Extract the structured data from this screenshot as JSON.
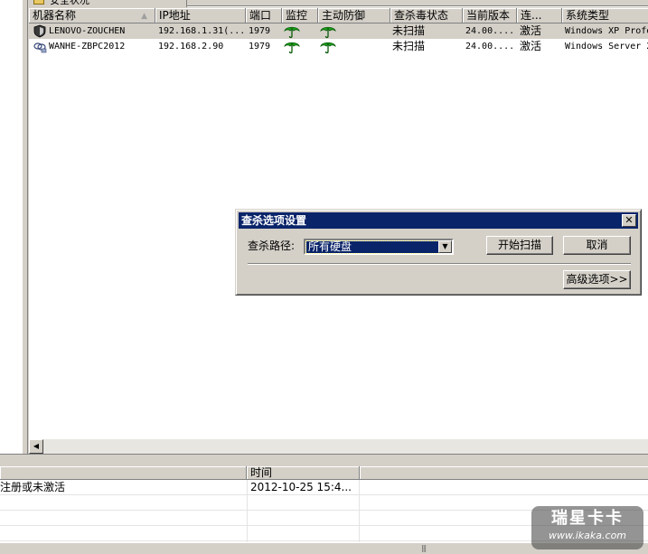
{
  "top_tab": {
    "label": "安全状况"
  },
  "machine_list": {
    "columns": [
      {
        "label": "机器名称"
      },
      {
        "label": "IP地址"
      },
      {
        "label": "端口"
      },
      {
        "label": "监控"
      },
      {
        "label": "主动防御"
      },
      {
        "label": "查杀毒状态"
      },
      {
        "label": "当前版本"
      },
      {
        "label": "连..."
      },
      {
        "label": "系统类型"
      }
    ],
    "sorted_column": "机器名称",
    "rows": [
      {
        "name": "LENOVO-ZOUCHEN",
        "icon": "shield-pc-icon",
        "ip": "192.168.1.31(...",
        "port": "1979",
        "monitor_icon": "umbrella-icon",
        "defense_icon": "umbrella-icon",
        "scan_status": "未扫描",
        "version": "24.00....",
        "connection": "激活",
        "os": "Windows XP Professional",
        "selected": true
      },
      {
        "name": "WANHE-ZBPC2012",
        "icon": "network-pc-icon",
        "ip": "192.168.2.90",
        "port": "1979",
        "monitor_icon": "umbrella-icon",
        "defense_icon": "umbrella-icon",
        "scan_status": "未扫描",
        "version": "24.00....",
        "connection": "激活",
        "os": "Windows Server 2",
        "selected": false
      }
    ]
  },
  "log_list": {
    "columns": [
      {
        "label": ""
      },
      {
        "label": "时间"
      },
      {
        "label": ""
      }
    ],
    "rows": [
      {
        "message": "注册或未激活",
        "time": "2012-10-25 15:4..."
      }
    ]
  },
  "dialog": {
    "title": "查杀选项设置",
    "close_label": "✕",
    "path_label": "查杀路径:",
    "path_value": "所有硬盘",
    "start_button": "开始扫描",
    "cancel_button": "取消",
    "advanced_button": "高级选项>>"
  },
  "watermark": {
    "logo": "瑞星卡卡",
    "url": "www.ikaka.com"
  },
  "colors": {
    "title_bar": "#0a246a",
    "window_face": "#d4d0c8",
    "umbrella_green": "#1aa01a"
  }
}
